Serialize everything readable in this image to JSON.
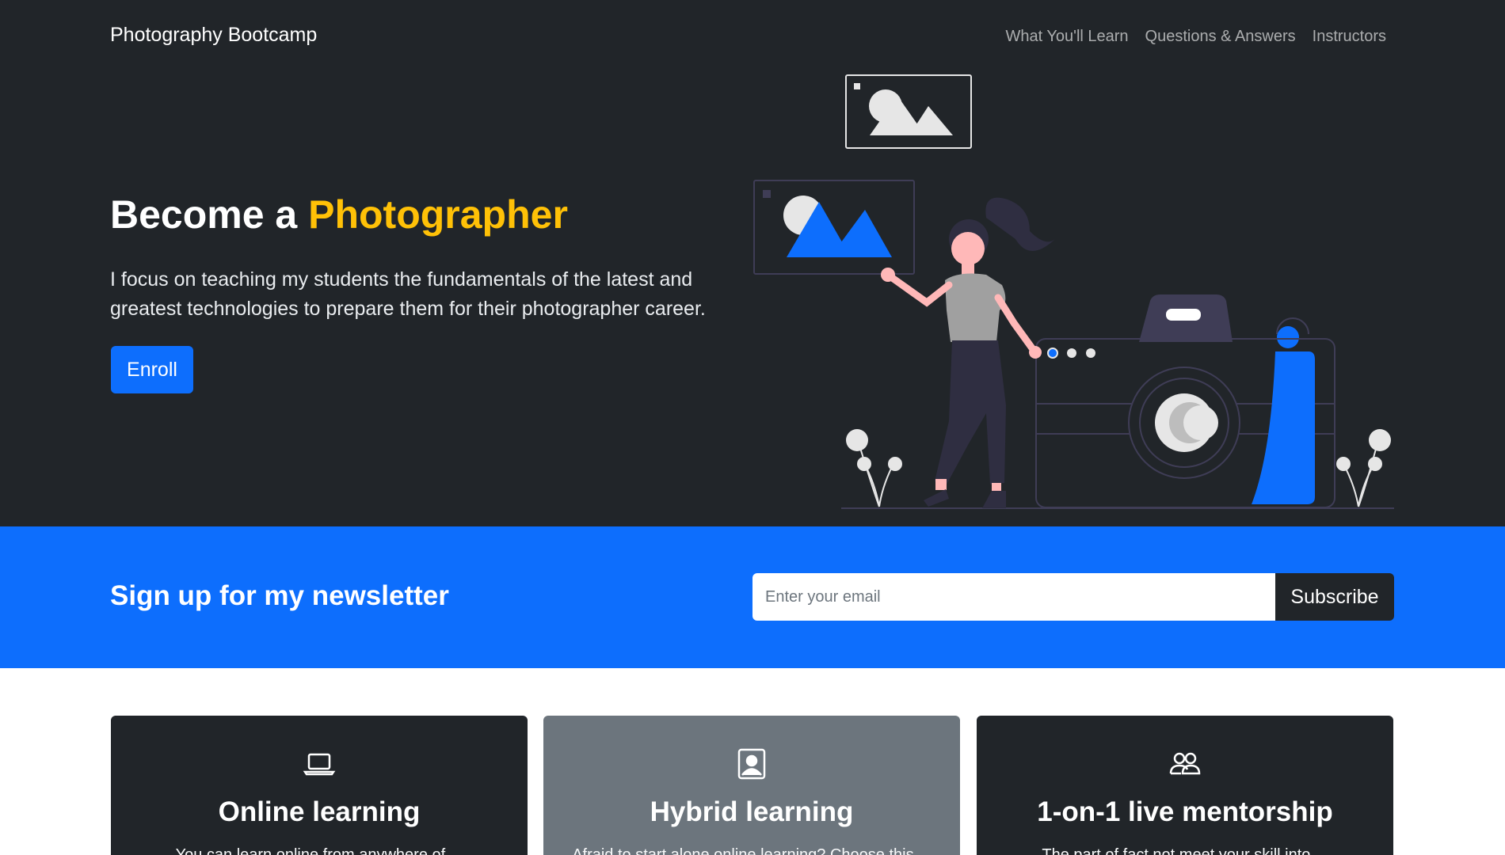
{
  "nav": {
    "brand": "Photography Bootcamp",
    "links": [
      "What You'll Learn",
      "Questions & Answers",
      "Instructors"
    ]
  },
  "hero": {
    "title_prefix": "Become a ",
    "title_accent": "Photographer",
    "lead": "I focus on teaching my students the fundamentals of the latest and greatest technologies to prepare them for their photographer career.",
    "cta": "Enroll"
  },
  "newsletter": {
    "title": "Sign up for my newsletter",
    "email_placeholder": "Enter your email",
    "email_value": "",
    "submit": "Subscribe"
  },
  "cards": [
    {
      "title": "Online learning",
      "text": "You can learn online from anywhere of ...",
      "icon": "laptop-icon"
    },
    {
      "title": "Hybrid learning",
      "text": "Afraid to start alone online learning? Choose this ...",
      "icon": "person-badge-icon"
    },
    {
      "title": "1-on-1 live mentorship",
      "text": "The part of fact not meet your skill into ...",
      "icon": "people-icon"
    }
  ],
  "colors": {
    "dark": "#212529",
    "primary": "#0d6efd",
    "accent": "#ffc107",
    "secondary": "#6c757d"
  }
}
